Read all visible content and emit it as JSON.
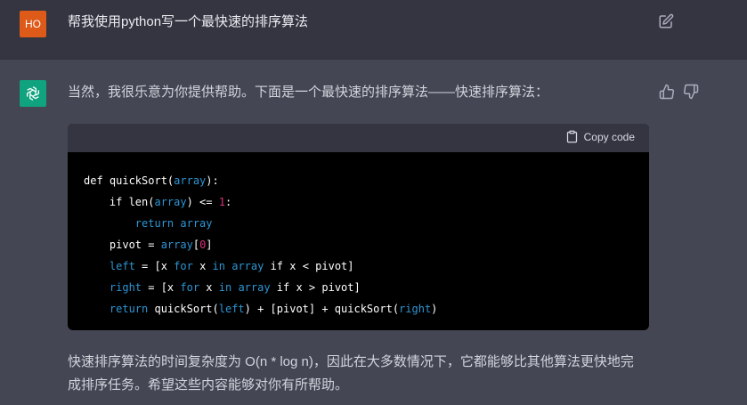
{
  "user": {
    "avatar_initials": "HO",
    "message": "帮我使用python写一个最快速的排序算法"
  },
  "assistant": {
    "intro": "当然，我很乐意为你提供帮助。下面是一个最快速的排序算法——快速排序算法：",
    "copy_label": "Copy code",
    "code_lines": [
      [
        {
          "t": "def quickSort("
        },
        {
          "t": "array",
          "c": "var"
        },
        {
          "t": "):"
        }
      ],
      [
        {
          "t": "    if len("
        },
        {
          "t": "array",
          "c": "var"
        },
        {
          "t": ") <= "
        },
        {
          "t": "1",
          "c": "num"
        },
        {
          "t": ":"
        }
      ],
      [
        {
          "t": "        "
        },
        {
          "t": "return array",
          "c": "kw"
        }
      ],
      [
        {
          "t": "    pivot = "
        },
        {
          "t": "array",
          "c": "var"
        },
        {
          "t": "["
        },
        {
          "t": "0",
          "c": "num"
        },
        {
          "t": "]"
        }
      ],
      [
        {
          "t": "    "
        },
        {
          "t": "left",
          "c": "var"
        },
        {
          "t": " = [x "
        },
        {
          "t": "for",
          "c": "kw"
        },
        {
          "t": " x "
        },
        {
          "t": "in",
          "c": "kw"
        },
        {
          "t": " "
        },
        {
          "t": "array",
          "c": "var"
        },
        {
          "t": " if x < pivot]"
        }
      ],
      [
        {
          "t": "    "
        },
        {
          "t": "right",
          "c": "var"
        },
        {
          "t": " = [x "
        },
        {
          "t": "for",
          "c": "kw"
        },
        {
          "t": " x "
        },
        {
          "t": "in",
          "c": "kw"
        },
        {
          "t": " "
        },
        {
          "t": "array",
          "c": "var"
        },
        {
          "t": " if x > pivot]"
        }
      ],
      [
        {
          "t": "    "
        },
        {
          "t": "return",
          "c": "kw"
        },
        {
          "t": " quickSort("
        },
        {
          "t": "left",
          "c": "var"
        },
        {
          "t": ") + [pivot] + quickSort("
        },
        {
          "t": "right",
          "c": "var"
        },
        {
          "t": ")"
        }
      ]
    ],
    "footer": "快速排序算法的时间复杂度为 O(n * log n)，因此在大多数情况下，它都能够比其他算法更快地完成排序任务。希望这些内容能够对你有所帮助。"
  },
  "icons": {
    "edit": "edit-icon",
    "thumbs_up": "thumbs-up-icon",
    "thumbs_down": "thumbs-down-icon",
    "clipboard": "clipboard-icon",
    "openai_logo": "openai-logo-icon"
  },
  "colors": {
    "page_bg": "#444654",
    "user_row_bg": "#343541",
    "user_avatar": "#dd5a18",
    "bot_avatar": "#10a37f",
    "code_bg": "#000000",
    "code_header_bg": "#343541"
  }
}
